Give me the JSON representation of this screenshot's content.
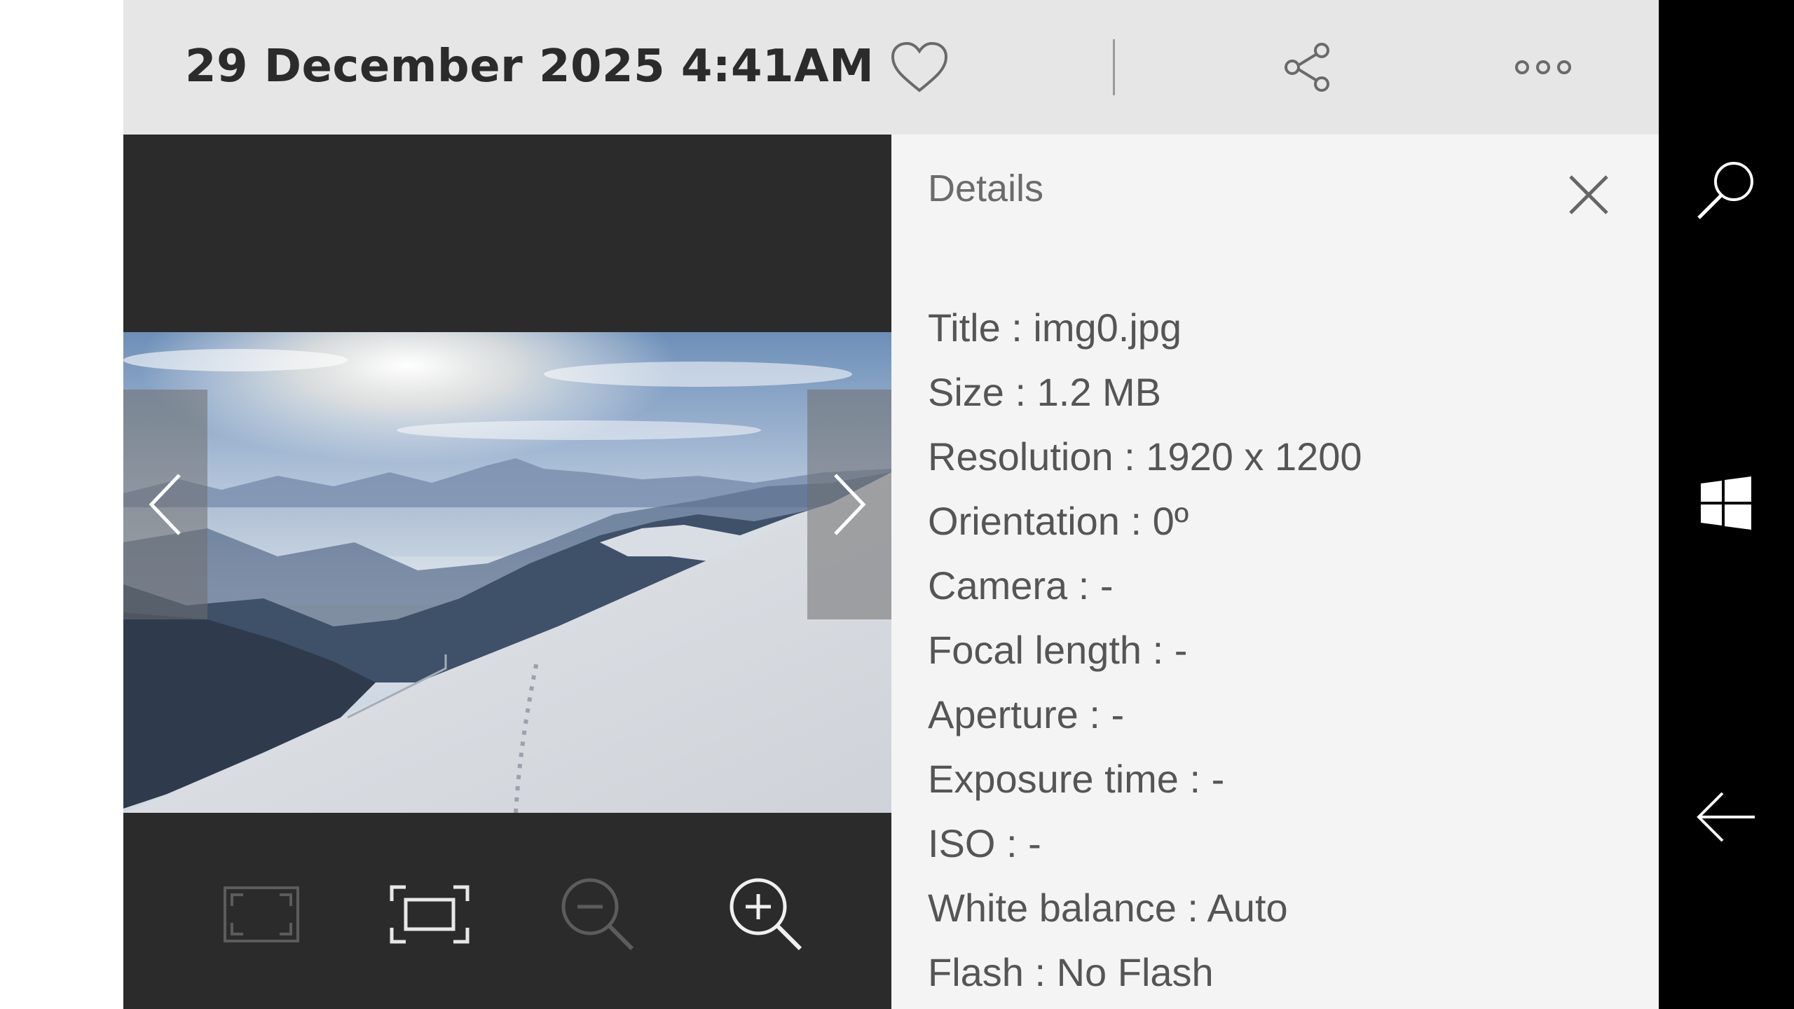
{
  "header": {
    "datetime": "29 December 2025 4:41AM",
    "icons": [
      "heart-icon",
      "share-icon",
      "more-icon"
    ]
  },
  "viewer": {
    "image_description_icon": "mountain-snow-photo",
    "nav": {
      "prev_icon": "chevron-left-icon",
      "next_icon": "chevron-right-icon"
    },
    "tools": [
      "fit-screen-icon",
      "actual-size-icon",
      "zoom-out-icon",
      "zoom-in-icon"
    ],
    "zoom_out_enabled": false,
    "fit_enabled": false
  },
  "details": {
    "heading": "Details",
    "rows": [
      "Title : img0.jpg",
      "Size : 1.2 MB",
      "Resolution : 1920 x 1200",
      "Orientation : 0º",
      "Camera : -",
      "Focal length : -",
      "Aperture : -",
      "Exposure time : -",
      "ISO : -",
      "White balance : Auto",
      "Flash : No Flash"
    ]
  },
  "system": {
    "icons": [
      "search-icon",
      "windows-start-icon",
      "back-arrow-icon"
    ]
  },
  "colors": {
    "topbar": "#e6e6e6",
    "viewer_bg": "#2b2b2b",
    "panel_bg": "#f4f4f4",
    "system_bar": "#000000"
  }
}
